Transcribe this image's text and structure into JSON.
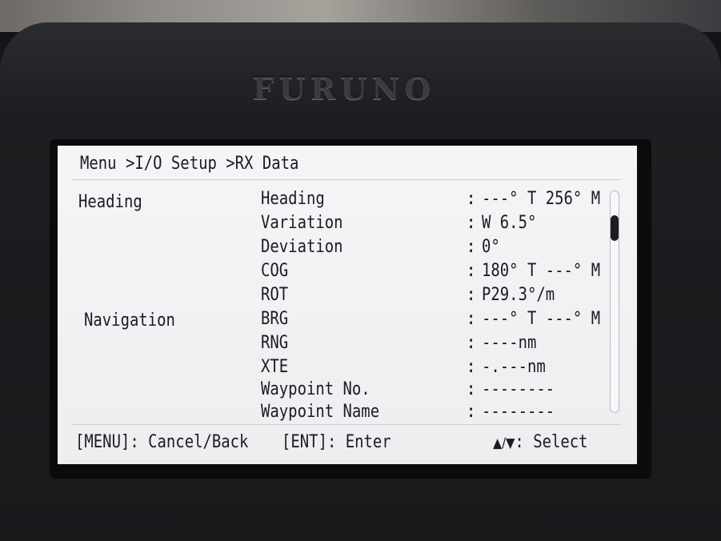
{
  "device": {
    "brand": "FURUNO"
  },
  "breadcrumb": "Menu >I/O Setup >RX Data",
  "groups": {
    "heading": "Heading",
    "navigation": "Navigation"
  },
  "rows": [
    {
      "name": "Heading",
      "value": "---° T 256° M"
    },
    {
      "name": "Variation",
      "value": "W 6.5°"
    },
    {
      "name": "Deviation",
      "value": "0°"
    },
    {
      "name": "COG",
      "value": "180° T ---° M"
    },
    {
      "name": "ROT",
      "value": "P29.3°/m"
    },
    {
      "name": "BRG",
      "value": "---° T ---° M"
    },
    {
      "name": "RNG",
      "value": "----nm"
    },
    {
      "name": "XTE",
      "value": "-.---nm"
    },
    {
      "name": "Waypoint No.",
      "value": "--------"
    },
    {
      "name": "Waypoint Name",
      "value": "--------"
    }
  ],
  "separator": ":",
  "footer": {
    "menu_key": "[MENU]: Cancel/Back",
    "ent_key": "[ENT]: Enter",
    "select_arrows": "▲/▼",
    "select_label": ": Select"
  },
  "colors": {
    "screen_bg": "#f0f1f3",
    "text": "#1a1c22",
    "bezel": "#1d1e21"
  }
}
